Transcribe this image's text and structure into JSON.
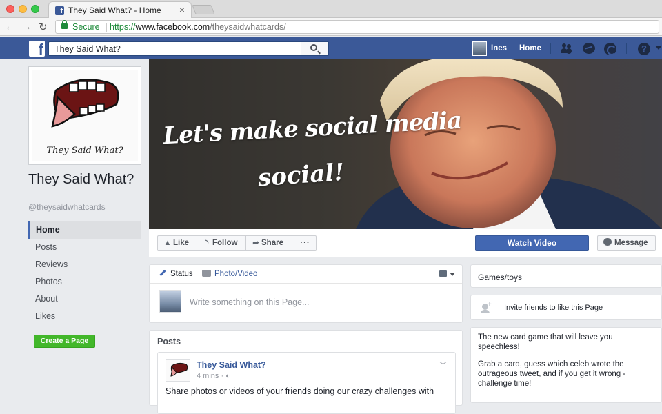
{
  "browser": {
    "tab_title": "They Said What? - Home",
    "tab_close": "×",
    "secure_label": "Secure",
    "url_scheme": "https://",
    "url_host": "www.facebook.com",
    "url_path": "/theysaidwhatcards/"
  },
  "topbar": {
    "search_value": "They Said What?",
    "user_name": "Ines",
    "home_label": "Home",
    "help_glyph": "?",
    "icons": [
      "friends-icon",
      "messenger-icon",
      "notifications-icon",
      "help-icon",
      "menu-caret-icon"
    ],
    "brand_color": "#3b5998"
  },
  "page": {
    "logo_text": "They Said What?",
    "name": "They Said What?",
    "handle": "@theysaidwhatcards",
    "create_page_label": "Create a Page"
  },
  "leftnav": {
    "items": [
      {
        "label": "Home",
        "active": true
      },
      {
        "label": "Posts"
      },
      {
        "label": "Reviews"
      },
      {
        "label": "Photos"
      },
      {
        "label": "About"
      },
      {
        "label": "Likes"
      }
    ]
  },
  "cover": {
    "line1": "Let's make social media",
    "line2": "social!"
  },
  "actions": {
    "like": "Like",
    "follow": "Follow",
    "share": "Share",
    "more": "···",
    "watch_video": "Watch Video",
    "message": "Message"
  },
  "composer": {
    "status_tab": "Status",
    "photo_tab": "Photo/Video",
    "placeholder": "Write something on this Page..."
  },
  "posts": {
    "title": "Posts",
    "items": [
      {
        "author": "They Said What?",
        "time": "4 mins · ◐",
        "text": "Share photos or videos of your friends doing our crazy challenges with"
      }
    ]
  },
  "sidebar_right": {
    "category": "Games/toys",
    "invite": "Invite friends to like this Page",
    "about_p1": "The new card game that will leave you speechless!",
    "about_p2": "Grab a card, guess which celeb wrote the outrageous tweet, and if you get it wrong - challenge time!"
  }
}
